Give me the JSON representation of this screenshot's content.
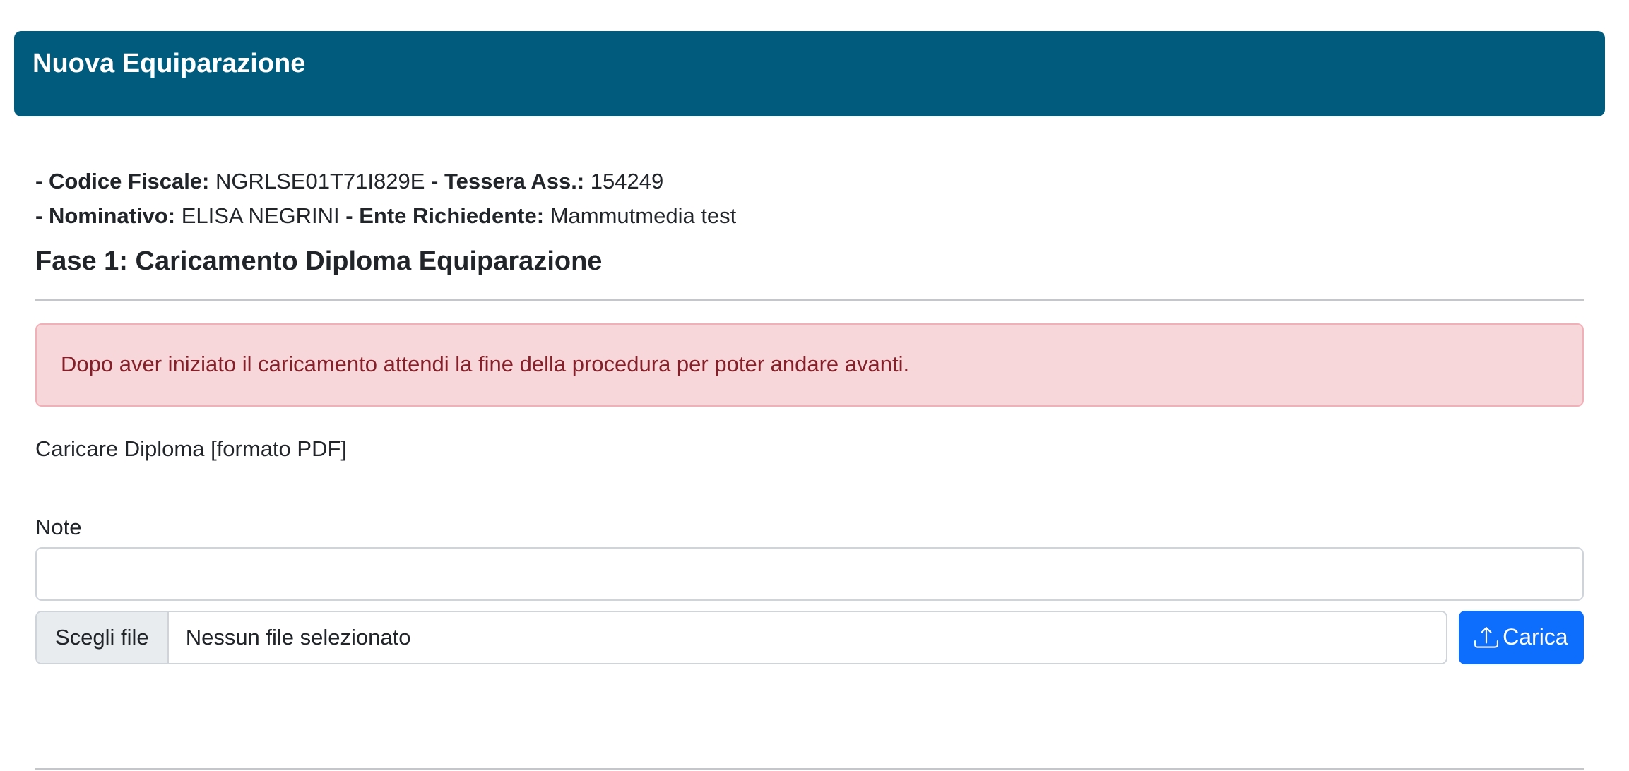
{
  "header": {
    "title": "Nuova Equiparazione"
  },
  "info": {
    "prefix": "-",
    "codice_fiscale_label": "Codice Fiscale:",
    "codice_fiscale_value": "NGRLSE01T71I829E",
    "separator": "-",
    "tessera_label": "Tessera Ass.:",
    "tessera_value": "154249",
    "nominativo_label": "Nominativo:",
    "nominativo_value": "ELISA NEGRINI",
    "ente_label": "Ente Richiedente:",
    "ente_value": "Mammutmedia test"
  },
  "section": {
    "title": "Fase 1: Caricamento Diploma Equiparazione"
  },
  "alert": {
    "text": "Dopo aver iniziato il caricamento attendi la fine della procedura per poter andare avanti."
  },
  "upload": {
    "label": "Caricare Diploma [formato PDF]",
    "note_label": "Note",
    "note_value": "",
    "choose_file_label": "Scegli file",
    "file_status": "Nessun file selezionato",
    "button_label": "Carica",
    "button_icon": "upload-icon"
  },
  "colors": {
    "header_bg": "#005b7d",
    "alert_bg": "#f8d7da",
    "alert_text": "#842029",
    "button_bg": "#0d6efd"
  }
}
